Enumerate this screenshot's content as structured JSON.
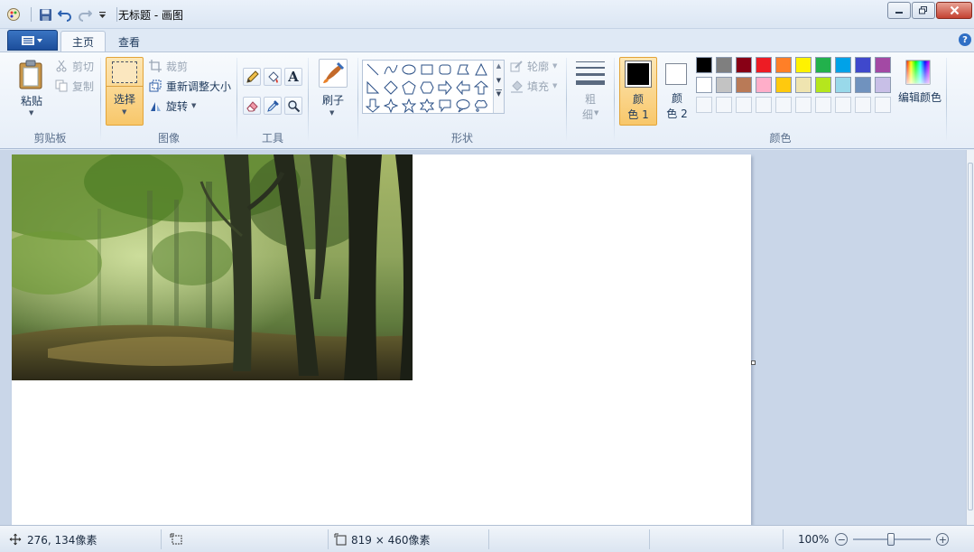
{
  "window": {
    "title": "无标题 - 画图"
  },
  "tabs": [
    {
      "label": "主页",
      "active": true
    },
    {
      "label": "查看",
      "active": false
    }
  ],
  "ribbon": {
    "clipboard": {
      "group_label": "剪贴板",
      "paste_label": "粘贴",
      "cut_label": "剪切",
      "copy_label": "复制"
    },
    "image": {
      "group_label": "图像",
      "select_label": "选择",
      "crop_label": "裁剪",
      "resize_label": "重新调整大小",
      "rotate_label": "旋转"
    },
    "tools": {
      "group_label": "工具"
    },
    "brushes": {
      "label": "刷子"
    },
    "shapes": {
      "group_label": "形状",
      "outline_label": "轮廓",
      "fill_label": "填充"
    },
    "size": {
      "label_line1": "粗",
      "label_line2": "细"
    },
    "colors": {
      "group_label": "颜色",
      "color1_line1": "颜",
      "color1_line2": "色 1",
      "color2_line1": "颜",
      "color2_line2": "色 2",
      "color1_value": "#000000",
      "color2_value": "#ffffff",
      "edit_colors_label": "编辑颜色",
      "palette_row1": [
        "#000000",
        "#7f7f7f",
        "#880015",
        "#ed1c24",
        "#ff7f27",
        "#fff200",
        "#22b14c",
        "#00a2e8",
        "#3f48cc",
        "#a349a4"
      ],
      "palette_row2": [
        "#ffffff",
        "#c3c3c3",
        "#b97a57",
        "#ffaec9",
        "#ffc90e",
        "#efe4b0",
        "#b5e61d",
        "#99d9ea",
        "#7092be",
        "#c8bfe7"
      ]
    }
  },
  "status": {
    "cursor_position": "276, 134像素",
    "canvas_size": "819 × 460像素",
    "zoom": "100%"
  },
  "accent": "#1c4e9b"
}
